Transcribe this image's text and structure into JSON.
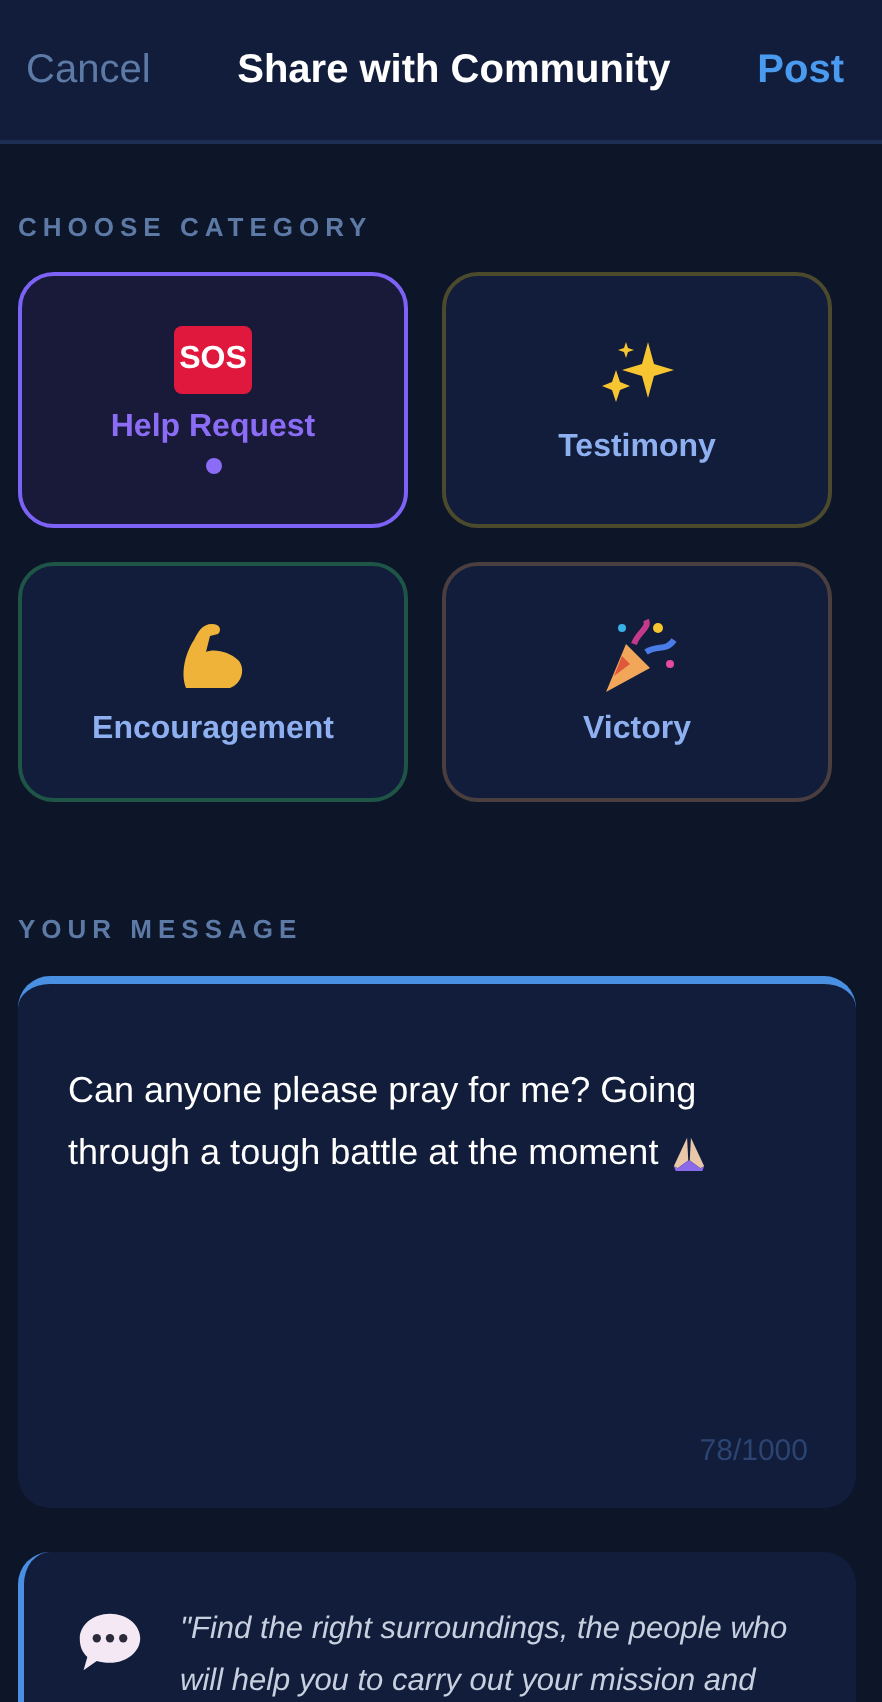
{
  "header": {
    "cancel": "Cancel",
    "title": "Share with Community",
    "post": "Post"
  },
  "category_section": {
    "label": "CHOOSE CATEGORY"
  },
  "categories": [
    {
      "kind": "sos",
      "badge": "SOS",
      "label": "Help Request",
      "selected": true,
      "color": "#7c63f5"
    },
    {
      "kind": "sparkles",
      "label": "Testimony",
      "selected": false,
      "color": "#4b4a2c"
    },
    {
      "kind": "muscle",
      "label": "Encouragement",
      "selected": false,
      "color": "#1e5546"
    },
    {
      "kind": "party",
      "label": "Victory",
      "selected": false,
      "color": "#4a3e3e"
    }
  ],
  "message_section": {
    "label": "YOUR MESSAGE"
  },
  "message": {
    "lines": [
      "Can anyone please pray for me? Going",
      "through a tough battle at the moment"
    ],
    "counter": "78/1000"
  },
  "quote": {
    "text": "\"Find the right surroundings, the people who will help you to carry out your mission and"
  }
}
